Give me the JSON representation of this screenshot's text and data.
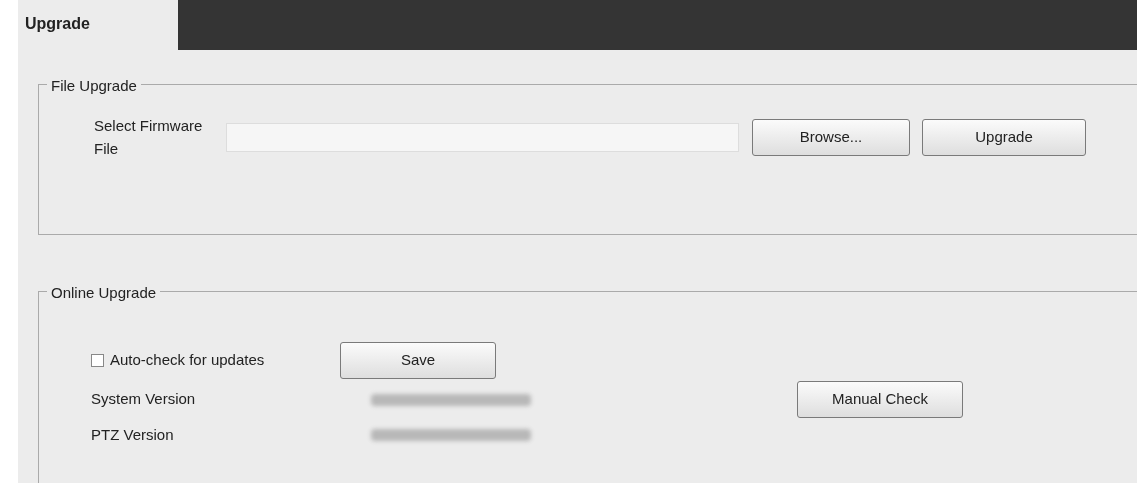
{
  "tabs": [
    {
      "label": "Upgrade",
      "selected": true
    }
  ],
  "file_upgrade": {
    "legend": "File Upgrade",
    "label": "Select Firmware File",
    "browse_button": "Browse...",
    "upgrade_button": "Upgrade"
  },
  "online_upgrade": {
    "legend": "Online Upgrade",
    "auto_check": {
      "label": "Auto-check for updates",
      "checked": false
    },
    "save_button": "Save",
    "system_version_label": "System Version",
    "ptz_version_label": "PTZ Version",
    "manual_check_button": "Manual Check"
  }
}
